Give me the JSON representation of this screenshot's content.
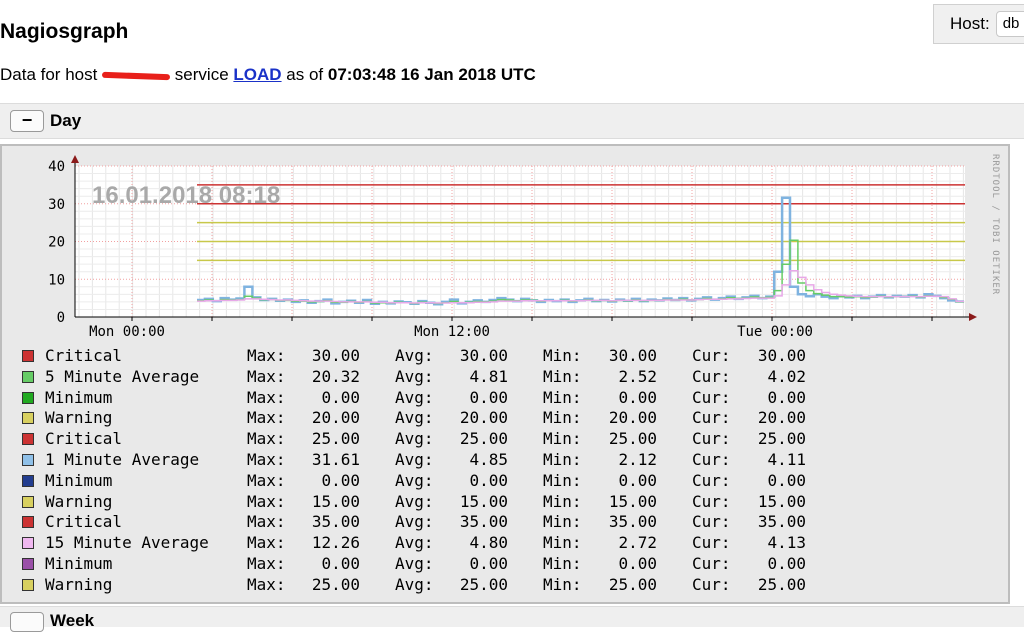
{
  "page": {
    "title": "Nagiosgraph",
    "host_label": "Host:",
    "host_value": "db",
    "data_prefix": "Data for host",
    "host_link": "",
    "service_word": "service",
    "service_link": "LOAD",
    "as_of_word": "as of",
    "timestamp": "07:03:48 16 Jan 2018 UTC"
  },
  "period": {
    "toggle_symbol": "−",
    "label": "Day",
    "next_label": "Week"
  },
  "graph": {
    "watermark": "16.01.2018 08:18",
    "side_label": "RRDTOOL / TOBI OETIKER",
    "colors": {
      "critical": "#cc3333",
      "warning": "#c8c84a",
      "avg1": "#7fb3e0",
      "avg5": "#66cc66",
      "avg15": "#e8a8e8",
      "axis": "#000000",
      "arrow": "#8b1a1a"
    }
  },
  "chart_data": {
    "type": "line",
    "ylim": [
      0,
      40
    ],
    "y_ticks": [
      0,
      10,
      20,
      30,
      40
    ],
    "x_ticks": [
      "Mon 00:00",
      "Mon 12:00",
      "Tue 00:00"
    ],
    "thresholds": [
      {
        "name": "Critical",
        "value": 35
      },
      {
        "name": "Critical",
        "value": 30
      },
      {
        "name": "Warning",
        "value": 25
      },
      {
        "name": "Warning",
        "value": 20
      },
      {
        "name": "Warning",
        "value": 15
      }
    ],
    "series": [
      {
        "name": "1 Minute Average",
        "values": [
          4.5,
          4.8,
          4.2,
          5.0,
          4.6,
          4.9,
          8.0,
          5.2,
          4.5,
          4.8,
          4.3,
          4.6,
          4.0,
          4.4,
          3.8,
          4.2,
          4.6,
          3.6,
          4.0,
          4.3,
          3.8,
          4.5,
          3.5,
          4.0,
          3.6,
          4.1,
          3.9,
          3.5,
          4.2,
          3.8,
          3.4,
          4.0,
          4.6,
          3.6,
          4.0,
          4.4,
          4.0,
          4.5,
          5.0,
          4.6,
          4.2,
          4.8,
          4.4,
          4.0,
          4.5,
          4.2,
          4.6,
          4.0,
          4.4,
          4.8,
          4.2,
          4.5,
          4.1,
          4.6,
          4.3,
          4.8,
          4.2,
          4.6,
          4.4,
          4.9,
          4.5,
          5.0,
          4.4,
          4.8,
          5.2,
          4.6,
          5.0,
          5.4,
          4.8,
          5.2,
          5.6,
          5.0,
          5.4,
          12.0,
          31.61,
          8.0,
          6.0,
          5.5,
          6.0,
          5.4,
          5.0,
          5.5,
          5.2,
          5.6,
          5.0,
          5.4,
          5.8,
          5.2,
          5.6,
          5.4,
          5.8,
          5.2,
          6.0,
          5.6,
          5.0,
          4.4,
          4.11
        ]
      },
      {
        "name": "5 Minute Average",
        "values": [
          4.3,
          4.5,
          4.3,
          4.6,
          4.5,
          4.6,
          5.5,
          5.0,
          4.6,
          4.6,
          4.4,
          4.4,
          4.2,
          4.2,
          4.0,
          4.1,
          4.3,
          3.9,
          3.9,
          4.1,
          3.9,
          4.1,
          3.7,
          3.8,
          3.7,
          3.9,
          3.8,
          3.6,
          3.9,
          3.8,
          3.6,
          3.8,
          4.1,
          3.8,
          3.9,
          4.1,
          4.0,
          4.2,
          4.6,
          4.5,
          4.3,
          4.5,
          4.4,
          4.2,
          4.3,
          4.3,
          4.4,
          4.2,
          4.3,
          4.5,
          4.3,
          4.4,
          4.2,
          4.4,
          4.3,
          4.5,
          4.3,
          4.4,
          4.4,
          4.6,
          4.5,
          4.7,
          4.5,
          4.6,
          4.9,
          4.7,
          4.8,
          5.1,
          4.9,
          5.0,
          5.3,
          5.1,
          5.2,
          7.0,
          14.0,
          20.32,
          9.0,
          7.0,
          6.2,
          5.8,
          5.4,
          5.4,
          5.3,
          5.4,
          5.2,
          5.3,
          5.5,
          5.3,
          5.4,
          5.4,
          5.5,
          5.3,
          5.6,
          5.5,
          5.2,
          4.7,
          4.02
        ]
      },
      {
        "name": "15 Minute Average",
        "values": [
          4.2,
          4.3,
          4.3,
          4.4,
          4.4,
          4.5,
          4.8,
          4.8,
          4.7,
          4.6,
          4.5,
          4.5,
          4.4,
          4.3,
          4.2,
          4.2,
          4.2,
          4.1,
          4.0,
          4.0,
          4.0,
          4.0,
          3.9,
          3.9,
          3.8,
          3.8,
          3.8,
          3.7,
          3.8,
          3.8,
          3.7,
          3.7,
          3.8,
          3.8,
          3.8,
          3.9,
          3.9,
          4.0,
          4.2,
          4.2,
          4.2,
          4.3,
          4.3,
          4.3,
          4.3,
          4.3,
          4.3,
          4.3,
          4.3,
          4.4,
          4.4,
          4.4,
          4.3,
          4.4,
          4.4,
          4.4,
          4.4,
          4.4,
          4.4,
          4.5,
          4.5,
          4.5,
          4.5,
          4.6,
          4.7,
          4.7,
          4.7,
          4.8,
          4.8,
          4.9,
          5.0,
          5.0,
          5.0,
          5.6,
          8.5,
          12.26,
          10.5,
          8.5,
          7.2,
          6.5,
          6.0,
          5.8,
          5.6,
          5.5,
          5.4,
          5.4,
          5.4,
          5.4,
          5.4,
          5.4,
          5.4,
          5.4,
          5.5,
          5.5,
          5.4,
          4.8,
          4.13
        ]
      }
    ]
  },
  "legend": {
    "labels": {
      "max": "Max:",
      "avg": "Avg:",
      "min": "Min:",
      "cur": "Cur:"
    },
    "rows": [
      {
        "name": "Critical",
        "color": "#cc3333",
        "max": "30.00",
        "avg": "30.00",
        "min": "30.00",
        "cur": "30.00"
      },
      {
        "name": "5 Minute Average",
        "color": "#66cc66",
        "max": "20.32",
        "avg": "4.81",
        "min": "2.52",
        "cur": "4.02"
      },
      {
        "name": "Minimum",
        "color": "#22aa22",
        "max": "0.00",
        "avg": "0.00",
        "min": "0.00",
        "cur": "0.00"
      },
      {
        "name": "Warning",
        "color": "#d8d060",
        "max": "20.00",
        "avg": "20.00",
        "min": "20.00",
        "cur": "20.00"
      },
      {
        "name": "Critical",
        "color": "#cc3333",
        "max": "25.00",
        "avg": "25.00",
        "min": "25.00",
        "cur": "25.00"
      },
      {
        "name": "1 Minute Average",
        "color": "#8fc0e8",
        "max": "31.61",
        "avg": "4.85",
        "min": "2.12",
        "cur": "4.11"
      },
      {
        "name": "Minimum",
        "color": "#223d8f",
        "max": "0.00",
        "avg": "0.00",
        "min": "0.00",
        "cur": "0.00"
      },
      {
        "name": "Warning",
        "color": "#d8d060",
        "max": "15.00",
        "avg": "15.00",
        "min": "15.00",
        "cur": "15.00"
      },
      {
        "name": "Critical",
        "color": "#cc3333",
        "max": "35.00",
        "avg": "35.00",
        "min": "35.00",
        "cur": "35.00"
      },
      {
        "name": "15 Minute Average",
        "color": "#f0b8f0",
        "max": "12.26",
        "avg": "4.80",
        "min": "2.72",
        "cur": "4.13"
      },
      {
        "name": "Minimum",
        "color": "#9a50a8",
        "max": "0.00",
        "avg": "0.00",
        "min": "0.00",
        "cur": "0.00"
      },
      {
        "name": "Warning",
        "color": "#d8d060",
        "max": "25.00",
        "avg": "25.00",
        "min": "25.00",
        "cur": "25.00"
      }
    ]
  }
}
